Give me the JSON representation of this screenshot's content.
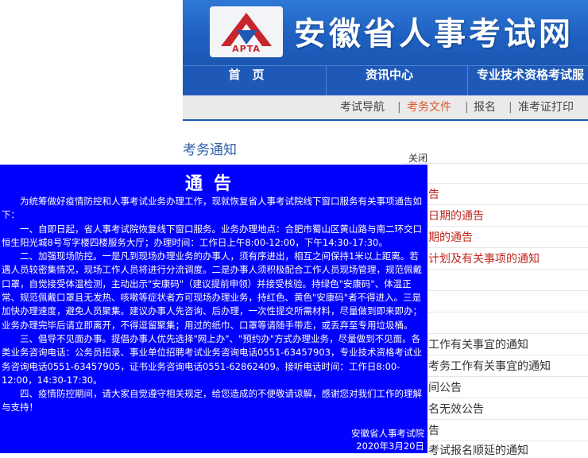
{
  "header": {
    "logo_text": "APTA",
    "site_title": "安徽省人事考试网"
  },
  "nav": {
    "items": [
      "首　页",
      "资讯中心",
      "专业技术资格考试服"
    ]
  },
  "subnav": {
    "items": [
      "考试导航",
      "考务文件",
      "报名",
      "准考证打印"
    ],
    "active": "考务文件"
  },
  "section": {
    "title": "考务通知",
    "close": "关闭"
  },
  "list_fragments": [
    {
      "text": "告",
      "color": "red"
    },
    {
      "text": "日期的通告",
      "color": "red"
    },
    {
      "text": "期的通告",
      "color": "red"
    },
    {
      "text": "计划及有关事项的通知",
      "color": "red"
    },
    {
      "text": "工作有关事宜的通知",
      "color": "dark"
    },
    {
      "text": "考务工作有关事宜的通知",
      "color": "dark"
    },
    {
      "text": "间公告",
      "color": "dark"
    },
    {
      "text": "名无效公告",
      "color": "dark"
    },
    {
      "text": "告",
      "color": "dark"
    },
    {
      "text": "考试报名顺延的通知",
      "color": "dark"
    }
  ],
  "popup": {
    "title": "通告",
    "paragraphs": [
      "为统筹做好疫情防控和人事考试业务办理工作，现就恢复省人事考试院线下窗口服务有关事项通告如下：",
      "一、自即日起，省人事考试院恢复线下窗口服务。业务办理地点：合肥市蜀山区黄山路与南二环交口恒生阳光城8号写字楼四楼服务大厅；办理时间：工作日上午8:00-12:00，下午14:30-17:30。",
      "二、加强现场防控。一是凡到现场办理业务的办事人，须有序进出，相互之间保持1米以上距离。若遇人员较密集情况，现场工作人员将进行分流调度。二是办事人须积极配合工作人员现场管理，规范佩戴口罩，自觉接受体温检测，主动出示\"安康码\"（建议提前申领）并接受核验。持绿色\"安康码\"、体温正常、规范佩戴口罩且无发热、咳嗽等症状者方可现场办理业务，持红色、黄色\"安康码\"者不得进入。三是加快办理速度，避免人员聚集。建议办事人先咨询、后办理，一次性提交所需材料，尽量做到即来即办；业务办理完毕后请立即离开，不得逗留聚集；用过的纸巾、口罩等请随手带走，或丢弃至专用垃圾桶。",
      "三、倡导不见面办事。提倡办事人优先选择\"网上办\"、\"预约办\"方式办理业务，尽量做到不见面。各类业务咨询电话：公务员招录、事业单位招聘考试业务咨询电话0551-63457903，专业技术资格考试业务咨询电话0551-63457905，证书业务咨询电话0551-62862409。接听电话时间：工作日8:00-12:00，14:30-17:30。",
      "四、疫情防控期间，请大家自觉遵守相关规定，给您造成的不便敬请谅解，感谢您对我们工作的理解与支持！"
    ],
    "signature": "安徽省人事考试院",
    "date": "2020年3月20日"
  }
}
